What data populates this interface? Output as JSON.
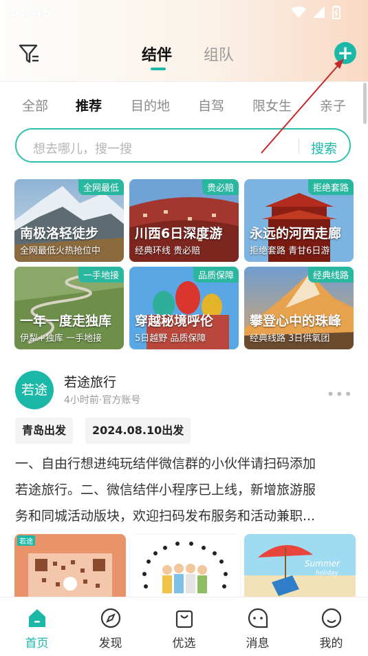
{
  "status": {
    "time": "11:46"
  },
  "header": {
    "tabs": [
      "结伴",
      "组队"
    ],
    "active_tab": "结伴"
  },
  "categories": [
    "全部",
    "推荐",
    "目的地",
    "自驾",
    "限女生",
    "亲子"
  ],
  "active_category": "推荐",
  "search": {
    "placeholder": "想去哪儿，搜一搜",
    "button": "搜索"
  },
  "cards": [
    {
      "badge": "全网最低",
      "title": "南极洛轻徒步",
      "subtitle": "全网最低火热抢位中"
    },
    {
      "badge": "贵必赔",
      "title": "川西6日深度游",
      "subtitle": "经典环线 贵必赔"
    },
    {
      "badge": "拒绝套路",
      "title": "永远的河西走廊",
      "subtitle": "拒绝套路 青甘6日游"
    },
    {
      "badge": "一手地接",
      "title": "一年一度走独库",
      "subtitle": "伊犁+独库 一手地接"
    },
    {
      "badge": "品质保障",
      "title": "穿越秘境呼伦",
      "subtitle": "5日越野 品质保障"
    },
    {
      "badge": "经典线路",
      "title": "攀登心中的珠峰",
      "subtitle": "经典线路 3日供氧团"
    }
  ],
  "post": {
    "avatar_text": "若途",
    "author": "若途旅行",
    "meta": "4小时前·官方账号",
    "tags": [
      "青岛出发",
      "2024.08.10出发"
    ],
    "text_lines": [
      "一、自由行想进纯玩结伴微信群的小伙伴请扫码添加",
      "若途旅行。二、微信结伴小程序已上线，新增旅游服",
      "务和同城活动版块，欢迎扫码发布服务和活动兼职..."
    ],
    "thumb_texts": {
      "brand": "若途",
      "summer": "Summer",
      "holiday": "holiday"
    }
  },
  "nav": [
    {
      "label": "首页",
      "icon": "home-icon"
    },
    {
      "label": "发现",
      "icon": "compass-icon"
    },
    {
      "label": "优选",
      "icon": "shopping-bag-icon"
    },
    {
      "label": "消息",
      "icon": "message-icon"
    },
    {
      "label": "我的",
      "icon": "profile-icon"
    }
  ],
  "colors": {
    "accent": "#1bb8a8",
    "annotation_arrow": "#c62828"
  }
}
